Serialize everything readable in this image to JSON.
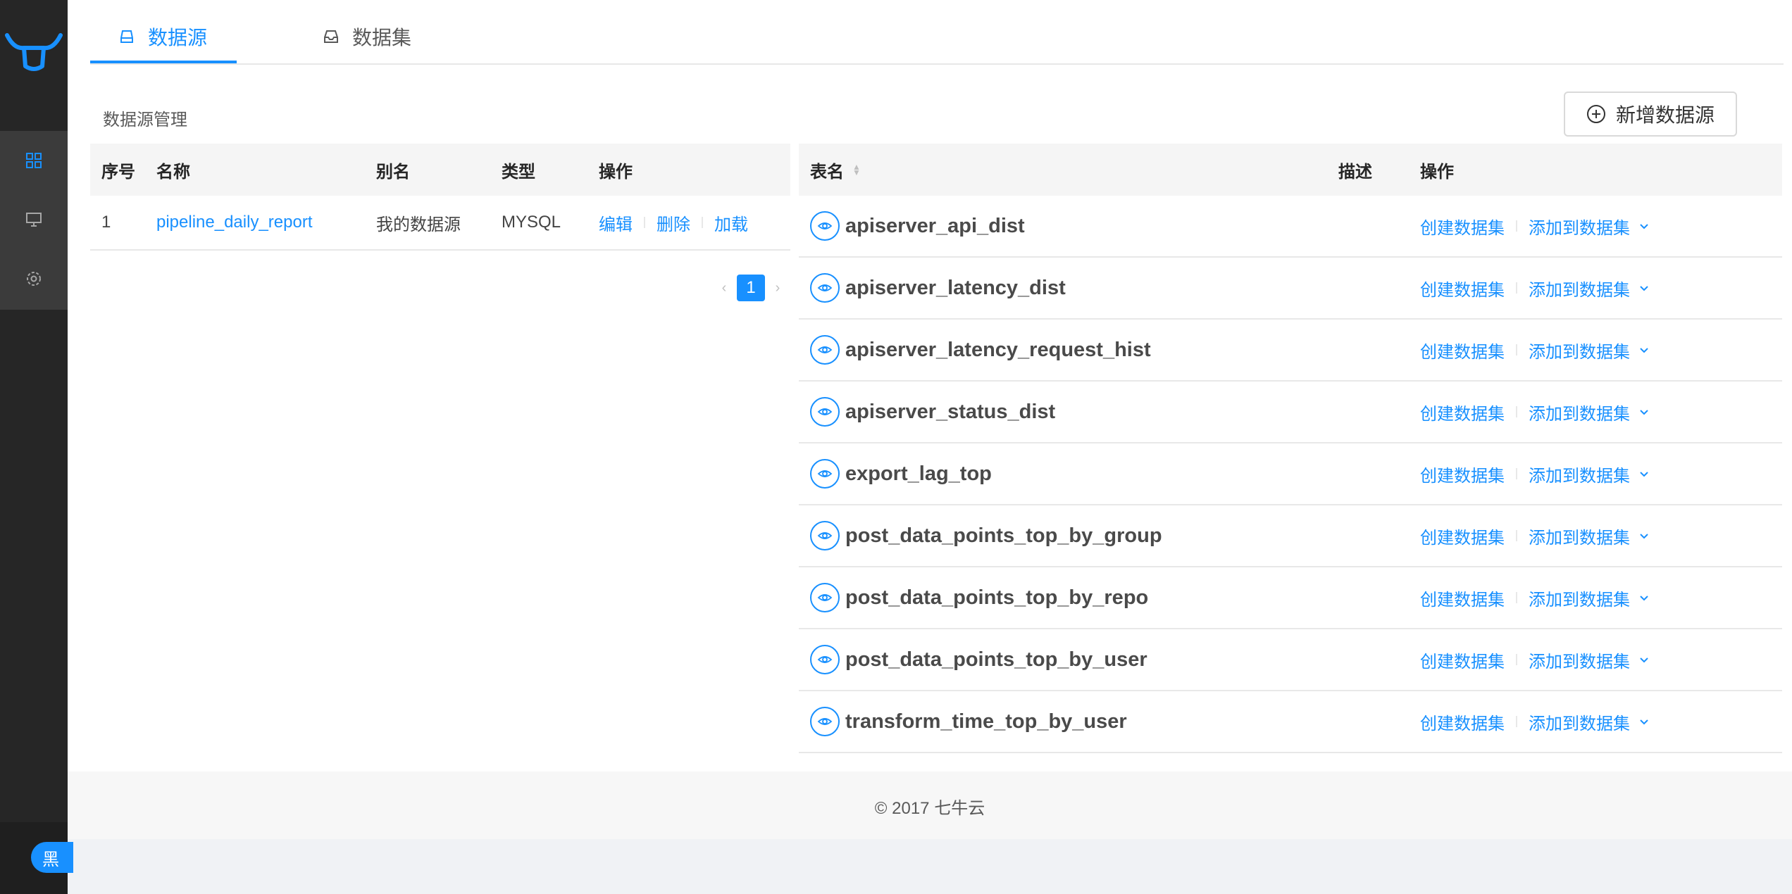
{
  "sidebar": {
    "menu": [
      "dashboard-icon",
      "monitor-icon",
      "settings-icon"
    ],
    "toggle_label": "黑"
  },
  "tabs": [
    {
      "label": "数据源",
      "icon": "database-icon",
      "active": true
    },
    {
      "label": "数据集",
      "icon": "inbox-icon",
      "active": false
    }
  ],
  "toolbar": {
    "section_title": "数据源管理",
    "add_button": "新增数据源"
  },
  "datasource_table": {
    "headers": [
      "序号",
      "名称",
      "别名",
      "类型",
      "操作"
    ],
    "rows": [
      {
        "index": "1",
        "name": "pipeline_daily_report",
        "alias": "我的数据源",
        "type": "MYSQL",
        "actions": [
          "编辑",
          "删除",
          "加载"
        ]
      }
    ]
  },
  "pagination": {
    "current": "1",
    "prev": "‹",
    "next": "›"
  },
  "tables_table": {
    "headers": [
      "表名",
      "描述",
      "操作"
    ],
    "action_create": "创建数据集",
    "action_add": "添加到数据集",
    "rows": [
      "apiserver_api_dist",
      "apiserver_latency_dist",
      "apiserver_latency_request_hist",
      "apiserver_status_dist",
      "export_lag_top",
      "post_data_points_top_by_group",
      "post_data_points_top_by_repo",
      "post_data_points_top_by_user",
      "transform_time_top_by_user"
    ]
  },
  "footer": {
    "text": "© 2017 七牛云"
  },
  "colors": {
    "accent": "#1890ff",
    "sidebar": "#262626"
  }
}
